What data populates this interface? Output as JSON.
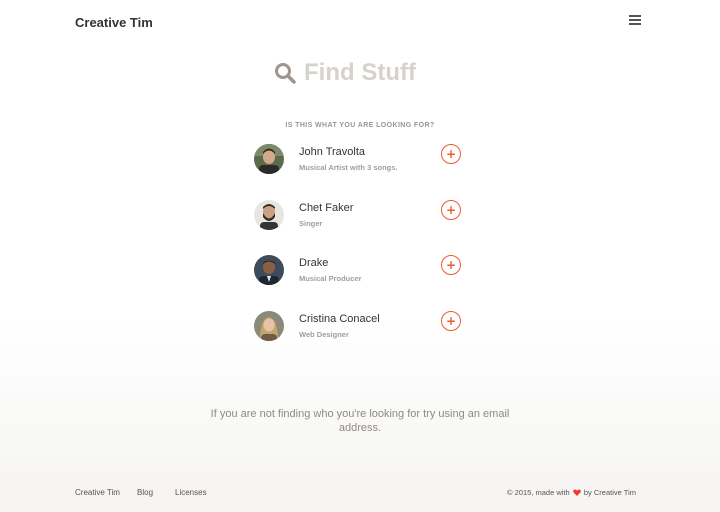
{
  "navbar": {
    "brand": "Creative Tim",
    "menu_icon": "hamburger-menu-icon"
  },
  "search": {
    "icon": "search-icon",
    "placeholder": "Find Stuff",
    "value": ""
  },
  "results": {
    "heading": "IS THIS WHAT YOU ARE LOOKING FOR?",
    "items": [
      {
        "name": "John Travolta",
        "role": "Musical Artist with 3 songs.",
        "action": "+"
      },
      {
        "name": "Chet Faker",
        "role": "Singer",
        "action": "+"
      },
      {
        "name": "Drake",
        "role": "Musical Producer",
        "action": "+"
      },
      {
        "name": "Cristina Conacel",
        "role": "Web Designer",
        "action": "+"
      }
    ]
  },
  "hint": {
    "text": "If you are not finding who you're looking for try using an email address."
  },
  "footer": {
    "links": [
      "Creative Tim",
      "Blog",
      "Licenses"
    ],
    "copyright_prefix": "© 2015, made with",
    "copyright_suffix": "by Creative Tim",
    "heart_color": "#ee3b2f"
  },
  "colors": {
    "accent": "#ee5a2f",
    "muted_text": "#a39e98"
  }
}
